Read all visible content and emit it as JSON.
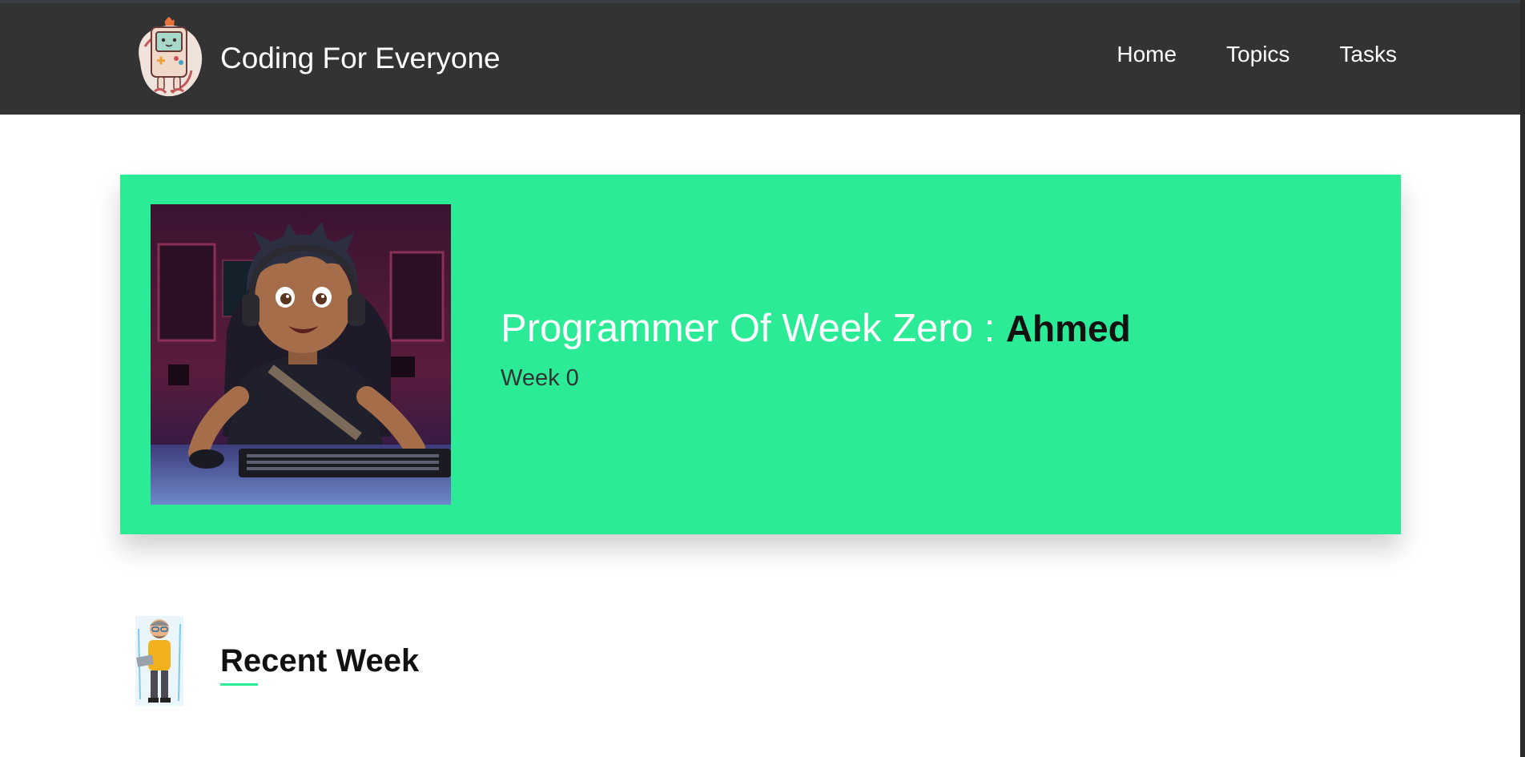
{
  "header": {
    "brand_title": "Coding For Everyone",
    "logo_icon": "gameboy-robot-logo-icon",
    "nav": [
      {
        "label": "Home"
      },
      {
        "label": "Topics"
      },
      {
        "label": "Tasks"
      }
    ]
  },
  "hero": {
    "title_prefix": "Programmer Of Week Zero : ",
    "name": "Ahmed",
    "subtitle": "Week 0",
    "image_icon": "boy-gamer-at-keyboard-illustration",
    "background_color": "#2ceb97"
  },
  "recent": {
    "heading": "Recent Week",
    "avatar_icon": "programmer-with-laptop-avatar-icon"
  },
  "colors": {
    "header_bg": "#333333",
    "accent": "#2ceb97",
    "text_dark": "#111111",
    "text_light": "#ffffff"
  }
}
